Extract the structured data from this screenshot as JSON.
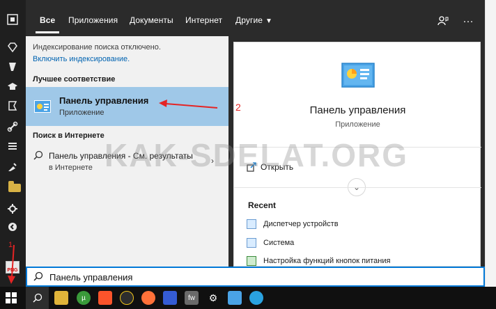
{
  "tabs": {
    "all": "Все",
    "apps": "Приложения",
    "documents": "Документы",
    "internet": "Интернет",
    "other": "Другие"
  },
  "left": {
    "notice": "Индексирование поиска отключено.",
    "enable_link": "Включить индексирование.",
    "best_match_header": "Лучшее соответствие",
    "best_title": "Панель управления",
    "best_subtitle": "Приложение",
    "web_header": "Поиск в Интернете",
    "web_line1": "Панель управления - См. результаты",
    "web_line2": "в Интернете"
  },
  "right": {
    "title": "Панель управления",
    "subtitle": "Приложение",
    "open_label": "Открыть",
    "recent_title": "Recent",
    "recent_items": [
      "Диспетчер устройств",
      "Система",
      "Настройка функций кнопок питания"
    ]
  },
  "search": {
    "value": "Панель управления"
  },
  "watermark": "KAK-SDELAT.ORG",
  "annotations": {
    "mark2": "2",
    "mark1": "1"
  },
  "colors": {
    "panel_bg": "#2b2b2b",
    "left_pane_bg": "#f1f1f1",
    "highlight": "#9fc8e8",
    "accent": "#0078d7",
    "annotation": "#e52424"
  },
  "icons": {
    "feedback": "feedback-icon",
    "more": "more-icon",
    "start": "windows-start-icon",
    "search": "search-icon"
  }
}
